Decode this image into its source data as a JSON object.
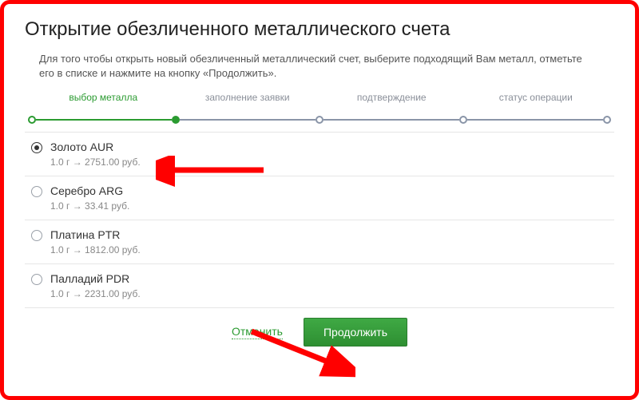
{
  "title": "Открытие обезличенного металлического счета",
  "intro": "Для того чтобы открыть новый обезличенный металлический счет, выберите подходящий Вам металл, отметьте его в списке и нажмите на кнопку «Продолжить».",
  "steps": {
    "s1": "выбор металла",
    "s2": "заполнение заявки",
    "s3": "подтверждение",
    "s4": "статус операции"
  },
  "metals": [
    {
      "name": "Золото AUR",
      "rate": "1.0 г → 2751.00 руб."
    },
    {
      "name": "Серебро ARG",
      "rate": "1.0 г → 33.41 руб."
    },
    {
      "name": "Платина PTR",
      "rate": "1.0 г → 1812.00 руб."
    },
    {
      "name": "Палладий PDR",
      "rate": "1.0 г → 2231.00 руб."
    }
  ],
  "actions": {
    "cancel": "Отменить",
    "continue": "Продолжить"
  }
}
